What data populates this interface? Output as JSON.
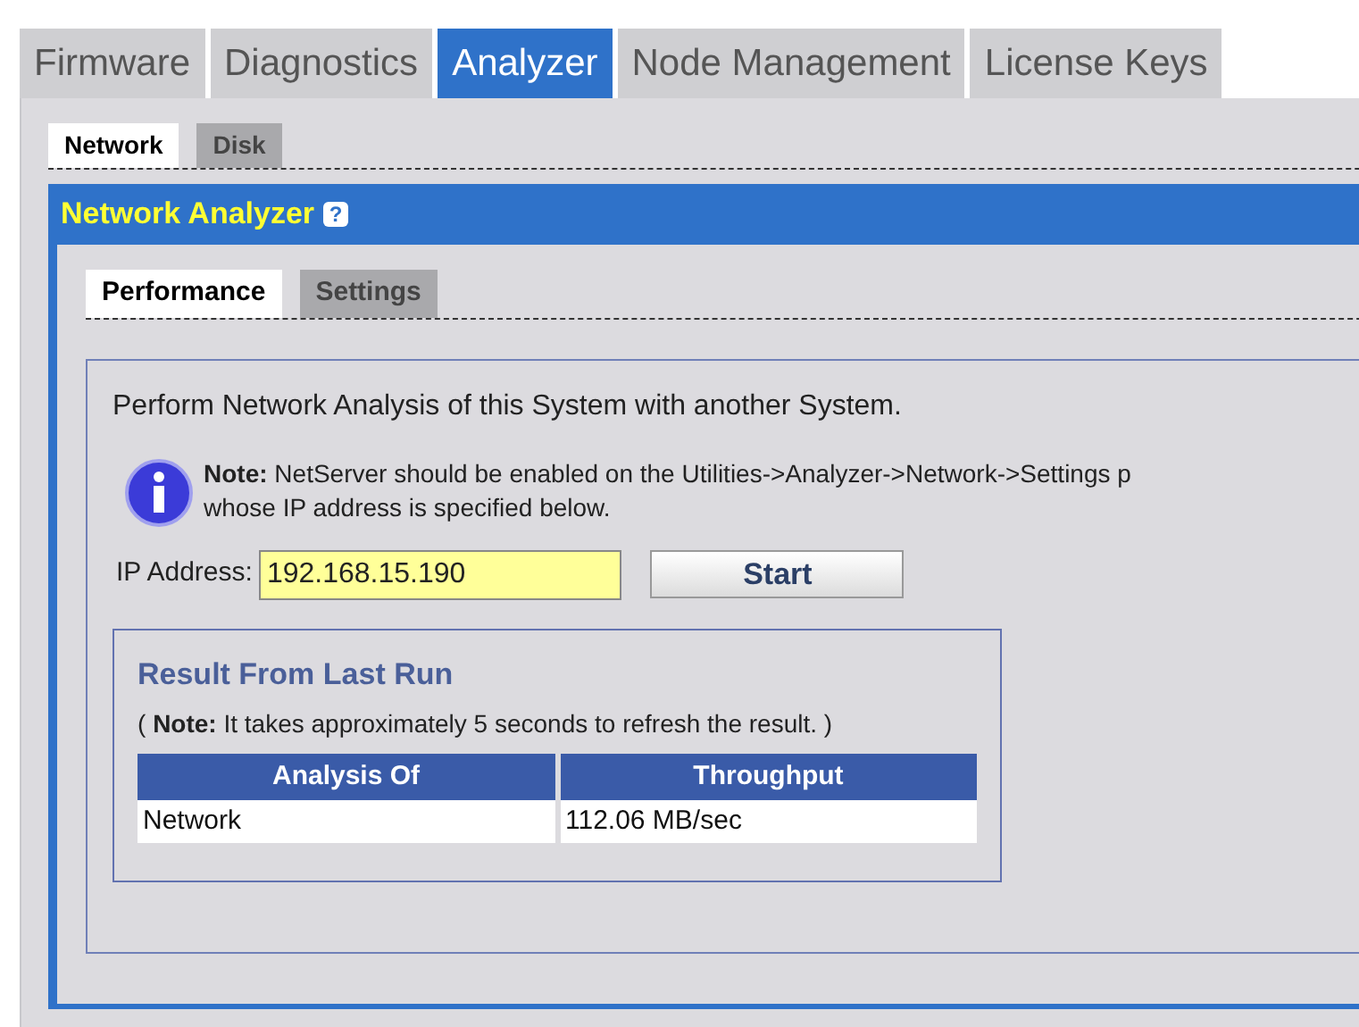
{
  "main_tabs": [
    {
      "label": "Firmware",
      "selected": false
    },
    {
      "label": "Diagnostics",
      "selected": false
    },
    {
      "label": "Analyzer",
      "selected": true
    },
    {
      "label": "Node Management",
      "selected": false
    },
    {
      "label": "License Keys",
      "selected": false
    }
  ],
  "sub_tabs": [
    {
      "label": "Network",
      "selected": true
    },
    {
      "label": "Disk",
      "selected": false
    }
  ],
  "panel": {
    "title": "Network Analyzer",
    "help_icon": "?",
    "tabs": [
      {
        "label": "Performance",
        "selected": true
      },
      {
        "label": "Settings",
        "selected": false
      }
    ],
    "intro": "Perform Network Analysis of this System with another System.",
    "note_lines": [
      "**Note:** NetServer should be enabled on the Utilities->Analyzer->Network->Settings p",
      "whose IP address is specified below."
    ],
    "ip_field": {
      "label": "IP Address:",
      "value": "192.168.15.190"
    },
    "start_button": "Start",
    "result": {
      "title": "Result From Last Run",
      "note": "( **Note:** It takes approximately 5 seconds to refresh the result. )",
      "columns": [
        "Analysis Of",
        "Throughput"
      ],
      "rows": [
        [
          "Network",
          "112.06 MB/sec"
        ]
      ]
    }
  }
}
